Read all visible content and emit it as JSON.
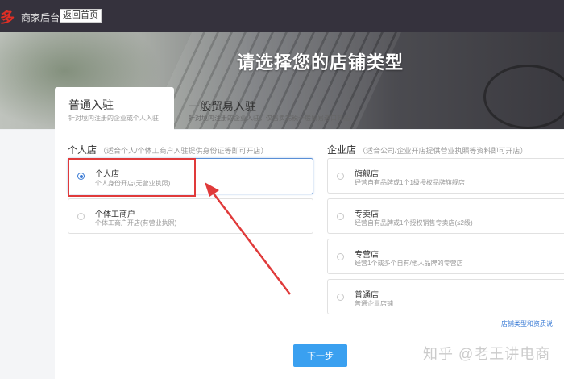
{
  "topbar": {
    "logo_text": "多",
    "merchant_label": "商家后台",
    "back_button": "返回首页"
  },
  "hero": {
    "title": "请选择您的店铺类型"
  },
  "tabs": [
    {
      "title": "普通入驻",
      "subtitle": "针对境内注册的企业或个人入驻",
      "active": true
    },
    {
      "title": "一般贸易入驻",
      "subtitle": "针对境内注册的企业入驻，仅售卖完税一般贸易进口商品",
      "active": false
    }
  ],
  "personal": {
    "heading": "个人店",
    "hint": "（适合个人/个体工商户入驻提供身份证等即可开店）",
    "options": [
      {
        "title": "个人店",
        "desc": "个人身份开店(无营业执照)",
        "selected": true
      },
      {
        "title": "个体工商户",
        "desc": "个体工商户开店(有营业执照)",
        "selected": false
      }
    ]
  },
  "enterprise": {
    "heading": "企业店",
    "hint": "（适合公司/企业开店提供营业执照等资料即可开店）",
    "options": [
      {
        "title": "旗舰店",
        "desc": "经营自有品牌或1个1级授权品牌旗舰店"
      },
      {
        "title": "专卖店",
        "desc": "经营自有品牌或1个授权销售专卖店(≤2级)"
      },
      {
        "title": "专营店",
        "desc": "经营1个或多个自有/他人品牌的专营店"
      },
      {
        "title": "普通店",
        "desc": "普通企业店铺"
      }
    ]
  },
  "link_text": "店铺类型和资质说",
  "next_button": "下一步",
  "watermark": "知乎 @老王讲电商",
  "colors": {
    "accent": "#3aa0f0",
    "annotation": "#e03a3a",
    "brand": "#e02e24"
  }
}
